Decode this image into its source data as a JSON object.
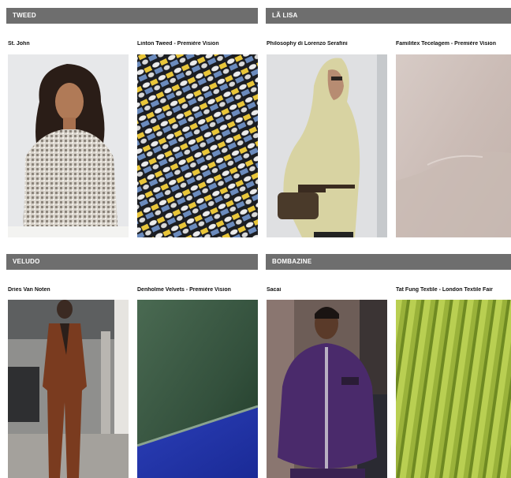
{
  "sections": [
    {
      "title": "TWEED",
      "items": [
        {
          "caption": "St. John",
          "image": "model-in-tweed-jacket"
        },
        {
          "caption": "Linton Tweed - Première Vision",
          "image": "tweed-fabric-swatch"
        }
      ]
    },
    {
      "title": "LÃ LISA",
      "items": [
        {
          "caption": "Philosophy di Lorenzo Serafini",
          "image": "model-in-hooded-wool-coat"
        },
        {
          "caption": "Familitex Tecelagem - Première Vision",
          "image": "beige-wool-fabric-swatch"
        }
      ]
    },
    {
      "title": "VELUDO",
      "items": [
        {
          "caption": "Dries Van Noten",
          "image": "runway-model-in-velvet-suit"
        },
        {
          "caption": "Denholme Velvets - Première Vision",
          "image": "green-blue-velvet-swatch"
        }
      ]
    },
    {
      "title": "BOMBAZINE",
      "items": [
        {
          "caption": "Sacai",
          "image": "runway-model-in-corduroy-puffer"
        },
        {
          "caption": "Tat Fung Textile - London Textile Fair",
          "image": "green-corduroy-swatch"
        }
      ]
    }
  ],
  "colors": {
    "header_bg": "#6e6e6e",
    "header_text": "#ffffff"
  }
}
